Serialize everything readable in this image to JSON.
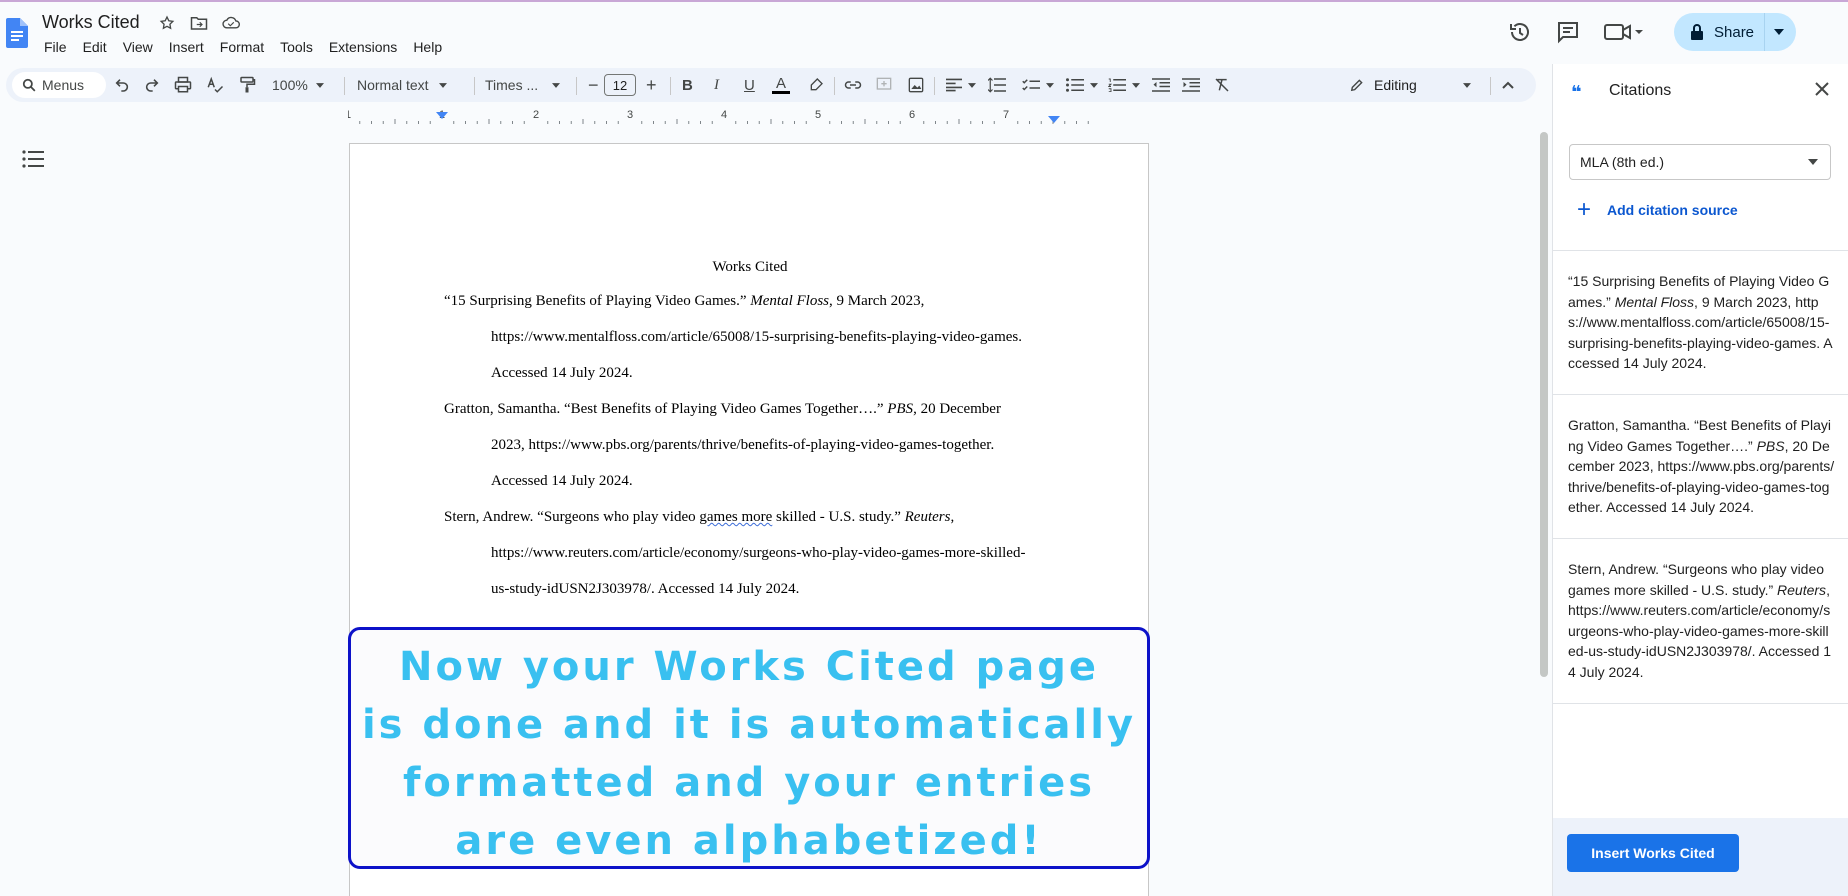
{
  "doc": {
    "title": "Works Cited",
    "menus": [
      "File",
      "Edit",
      "View",
      "Insert",
      "Format",
      "Tools",
      "Extensions",
      "Help"
    ],
    "share_label": "Share"
  },
  "toolbar": {
    "menus_search": "Menus",
    "zoom": "100%",
    "style": "Normal text",
    "font": "Times ...",
    "font_size": "12",
    "mode": "Editing"
  },
  "ruler": {
    "labels": [
      "1",
      "1",
      "2",
      "3",
      "4",
      "5",
      "6",
      "7"
    ]
  },
  "page": {
    "heading": "Works Cited",
    "entries": [
      {
        "line1_pre": "“15 Surprising Benefits of Playing Video Games.” ",
        "line1_italic": "Mental Floss",
        "line1_post": ", 9 March 2023,",
        "line2": "https://www.mentalfloss.com/article/65008/15-surprising-benefits-playing-video-games.",
        "line3": "Accessed 14 July 2024."
      },
      {
        "line1_pre": "Gratton, Samantha. “Best Benefits of Playing Video Games Together….” ",
        "line1_italic": "PBS",
        "line1_post": ", 20 December",
        "line2": "2023, https://www.pbs.org/parents/thrive/benefits-of-playing-video-games-together.",
        "line3": "Accessed 14 July 2024."
      },
      {
        "line1_pre": "Stern, Andrew. “Surgeons who play video ",
        "line1_squiggle": "games more",
        "line1_mid": " skilled - U.S. study.” ",
        "line1_italic": "Reuters",
        "line1_post": ",",
        "line2": "https://www.reuters.com/article/economy/surgeons-who-play-video-games-more-skilled-",
        "line3": "us-study-idUSN2J303978/. Accessed 14 July 2024."
      }
    ]
  },
  "callout": {
    "lines": [
      "Now your Works Cited page",
      "is done and it is automatically",
      "formatted and your entries",
      "are even alphabetized!"
    ]
  },
  "citations_panel": {
    "title": "Citations",
    "style_value": "MLA (8th ed.)",
    "add_label": "Add citation source",
    "cards": [
      {
        "pre": "“15 Surprising Benefits of Playing Video Games.” ",
        "italic": "Mental Floss",
        "post": ", 9 March 2023, https://www.mentalfloss.com/article/65008/15-surprising-benefits-playing-video-games. Accessed 14 July 2024."
      },
      {
        "pre": "Gratton, Samantha. “Best Benefits of Playing Video Games Together….” ",
        "italic": "PBS",
        "post": ", 20 December 2023, https://www.pbs.org/parents/thrive/benefits-of-playing-video-games-together. Accessed 14 July 2024."
      },
      {
        "pre": "Stern, Andrew. “Surgeons who play video games more skilled - U.S. study.” ",
        "italic": "Reuters",
        "post": ", https://www.reuters.com/article/economy/surgeons-who-play-video-games-more-skilled-us-study-idUSN2J303978/. Accessed 14 July 2024."
      }
    ],
    "insert_label": "Insert Works Cited"
  },
  "colors": {
    "accent": "#1a73e8",
    "share_bg": "#c2e7ff",
    "callout_text": "#39c0f0",
    "callout_border": "#0d12c9"
  }
}
